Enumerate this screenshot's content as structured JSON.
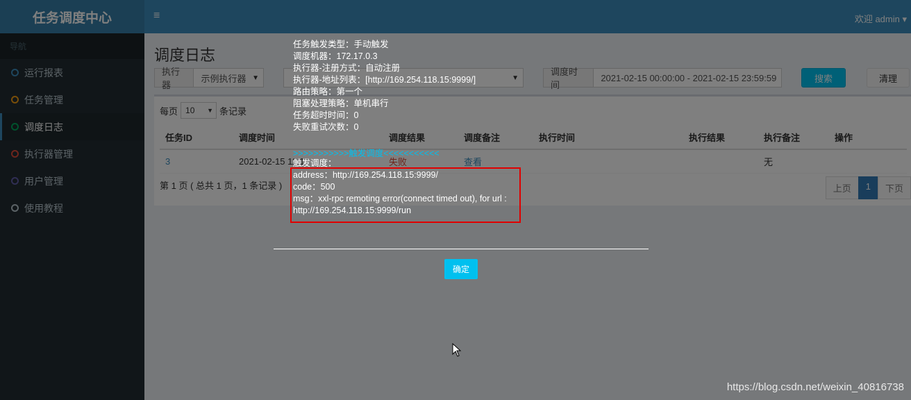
{
  "header": {
    "logo": "任务调度中心",
    "toggle_icon": "≡",
    "user": "欢迎 admin ▾"
  },
  "sidebar": {
    "header": "导航",
    "items": [
      {
        "label": "运行报表",
        "color": "#3c8dbc"
      },
      {
        "label": "任务管理",
        "color": "#f39c12"
      },
      {
        "label": "调度日志",
        "color": "#00a65a"
      },
      {
        "label": "执行器管理",
        "color": "#dd4b39"
      },
      {
        "label": "用户管理",
        "color": "#605ca8"
      },
      {
        "label": "使用教程",
        "color": "#b8c7ce"
      }
    ]
  },
  "main": {
    "title": "调度日志",
    "filters": {
      "executor_label": "执行器",
      "executor_value": "示例执行器",
      "time_label": "调度时间",
      "time_value": "2021-02-15 00:00:00 - 2021-02-15 23:59:59",
      "search": "搜索",
      "clear": "清理"
    },
    "perpage": {
      "prefix": "每页",
      "value": "10",
      "suffix": "条记录"
    },
    "table": {
      "headers": [
        "任务ID",
        "调度时间",
        "调度结果",
        "调度备注",
        "执行时间",
        "执行结果",
        "执行备注",
        "操作"
      ],
      "rows": [
        {
          "id": "3",
          "time": "2021-02-15 11:1",
          "result": "失败",
          "remark": "查看",
          "exec_time": "",
          "exec_result": "",
          "exec_remark": "无",
          "op": ""
        }
      ]
    },
    "page_info": "第 1 页 ( 总共 1 页，1 条记录 )",
    "pager": {
      "prev": "上页",
      "current": "1",
      "next": "下页"
    }
  },
  "modal": {
    "lines": [
      "任务触发类型：手动触发",
      "调度机器：172.17.0.3",
      "执行器-注册方式：自动注册",
      "执行器-地址列表：[http://169.254.118.15:9999/]",
      "路由策略：第一个",
      "阻塞处理策略：单机串行",
      "任务超时时间：0",
      "失败重试次数：0"
    ],
    "trigger_title": ">>>>>>>>>>>触发调度<<<<<<<<<<<",
    "trigger_lines": [
      "触发调度：",
      "address：http://169.254.118.15:9999/",
      "code：500",
      "msg：xxl-rpc remoting error(connect timed out), for url :",
      "http://169.254.118.15:9999/run"
    ],
    "confirm": "确定"
  },
  "watermark": "https://blog.csdn.net/weixin_40816738"
}
